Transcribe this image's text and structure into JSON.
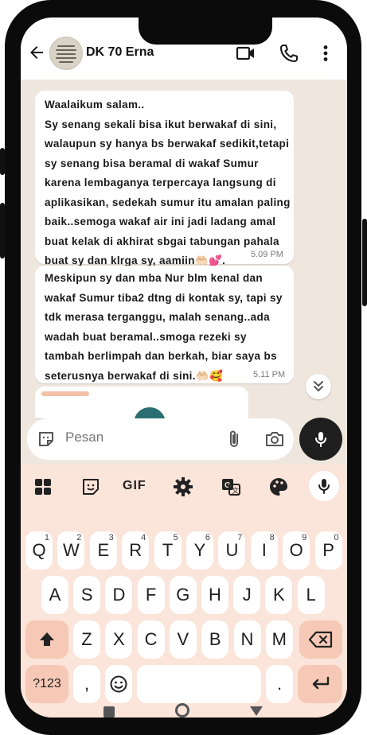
{
  "header": {
    "contact_name": "DK 70 Erna"
  },
  "messages": [
    {
      "text": "Waalaikum salam..\nSy senang sekali bisa ikut berwakaf di sini,\nwalaupun  sy hanya bs berwakaf sedikit,tetapi\nsy senang bisa beramal  di wakaf Sumur\nkarena lembaganya terpercaya langsung di\naplikasikan, sedekah sumur itu amalan paling\nbaik..semoga wakaf air ini jadi ladang amal\nbuat kelak di akhirat sbgai tabungan pahala\nbuat sy  dan klrga sy, aamiin🤲🏻💕.",
      "time": "5.09 PM"
    },
    {
      "text": "Meskipun sy dan mba Nur blm kenal dan\nwakaf Sumur tiba2 dtng di kontak sy, tapi sy\ntdk merasa terganggu, malah senang..ada\nwadah buat beramal..smoga rezeki sy\ntambah berlimpah dan berkah, biar saya  bs\nseterusnya berwakaf di sini.🤲🏻🥰",
      "time": "5.11 PM"
    }
  ],
  "input": {
    "placeholder": "Pesan"
  },
  "keyboard": {
    "toolbar": [
      "apps-icon",
      "sticker-icon",
      "GIF",
      "settings-icon",
      "translate-icon",
      "palette-icon",
      "mic-icon"
    ],
    "gif_label": "GIF",
    "row1": [
      {
        "k": "Q",
        "h": "1"
      },
      {
        "k": "W",
        "h": "2"
      },
      {
        "k": "E",
        "h": "3"
      },
      {
        "k": "R",
        "h": "4"
      },
      {
        "k": "T",
        "h": "5"
      },
      {
        "k": "Y",
        "h": "6"
      },
      {
        "k": "U",
        "h": "7"
      },
      {
        "k": "I",
        "h": "8"
      },
      {
        "k": "O",
        "h": "9"
      },
      {
        "k": "P",
        "h": "0"
      }
    ],
    "row2": [
      "A",
      "S",
      "D",
      "F",
      "G",
      "H",
      "J",
      "K",
      "L"
    ],
    "row3": [
      "Z",
      "X",
      "C",
      "V",
      "B",
      "N",
      "M"
    ],
    "symbols_label": "?123",
    "comma_label": ",",
    "period_label": "."
  },
  "colors": {
    "accent_mic": "#1f1f1f",
    "keyboard_bg": "#fbe4d9",
    "chat_bg": "#efe7de"
  }
}
